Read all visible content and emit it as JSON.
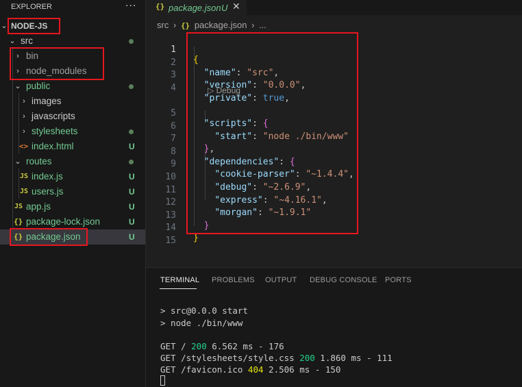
{
  "explorer": {
    "title": "EXPLORER",
    "more_label": "···",
    "items": [
      {
        "label": "NODE-JS",
        "kind": "root"
      },
      {
        "label": "src",
        "kind": "folder-open",
        "badge": "dot"
      },
      {
        "label": "bin",
        "kind": "folder-closed"
      },
      {
        "label": "node_modules",
        "kind": "folder-closed"
      },
      {
        "label": "public",
        "kind": "folder-open",
        "badge": "dot"
      },
      {
        "label": "images",
        "kind": "folder-closed"
      },
      {
        "label": "javascripts",
        "kind": "folder-closed"
      },
      {
        "label": "stylesheets",
        "kind": "folder-closed",
        "badge": "dot"
      },
      {
        "label": "index.html",
        "kind": "html-file",
        "badge": "U"
      },
      {
        "label": "routes",
        "kind": "folder-open",
        "badge": "dot"
      },
      {
        "label": "index.js",
        "kind": "js-file",
        "badge": "U"
      },
      {
        "label": "users.js",
        "kind": "js-file",
        "badge": "U"
      },
      {
        "label": "app.js",
        "kind": "js-file",
        "badge": "U"
      },
      {
        "label": "package-lock.json",
        "kind": "json-file",
        "badge": "U"
      },
      {
        "label": "package.json",
        "kind": "json-file",
        "badge": "U"
      }
    ]
  },
  "tab": {
    "icon": "{}",
    "label": "package.json",
    "status": "U",
    "close": "✕"
  },
  "breadcrumb": {
    "folder": "src",
    "sep": "›",
    "icon": "{}",
    "file": "package.json",
    "more": "..."
  },
  "editor": {
    "line_numbers": [
      "1",
      "2",
      "3",
      "4",
      "5",
      "6",
      "7",
      "8",
      "9",
      "10",
      "11",
      "12",
      "13",
      "14",
      "15"
    ],
    "codelens": "Debug",
    "punct": {
      "open": "{",
      "close": "}",
      "colon": ": ",
      "comma": ","
    },
    "lines": {
      "name_key": "\"name\"",
      "name_val": "\"src\"",
      "version_key": "\"version\"",
      "version_val": "\"0.0.0\"",
      "private_key": "\"private\"",
      "private_val": "true",
      "scripts_key": "\"scripts\"",
      "start_key": "\"start\"",
      "start_val": "\"node ./bin/www\"",
      "deps_key": "\"dependencies\"",
      "cp_key": "\"cookie-parser\"",
      "cp_val": "\"~1.4.4\"",
      "debug_key": "\"debug\"",
      "debug_val": "\"~2.6.9\"",
      "express_key": "\"express\"",
      "express_val": "\"~4.16.1\"",
      "morgan_key": "\"morgan\"",
      "morgan_val": "\"~1.9.1\""
    }
  },
  "panel": {
    "tabs": [
      "TERMINAL",
      "PROBLEMS",
      "OUTPUT",
      "DEBUG CONSOLE",
      "PORTS"
    ],
    "terminal": {
      "l1": "> src@0.0.0 start",
      "l2": "> node ./bin/www",
      "r1_pre": "GET / ",
      "r1_code": "200",
      "r1_post": " 6.562 ms - 176",
      "r2_pre": "GET /stylesheets/style.css ",
      "r2_code": "200",
      "r2_post": " 1.860 ms - 111",
      "r3_pre": "GET /favicon.ico ",
      "r3_code": "404",
      "r3_post": " 2.506 ms - 150"
    }
  },
  "colors": {
    "highlight": "#e8161f",
    "untracked": "#73c991",
    "json_icon": "#cbcb41"
  }
}
